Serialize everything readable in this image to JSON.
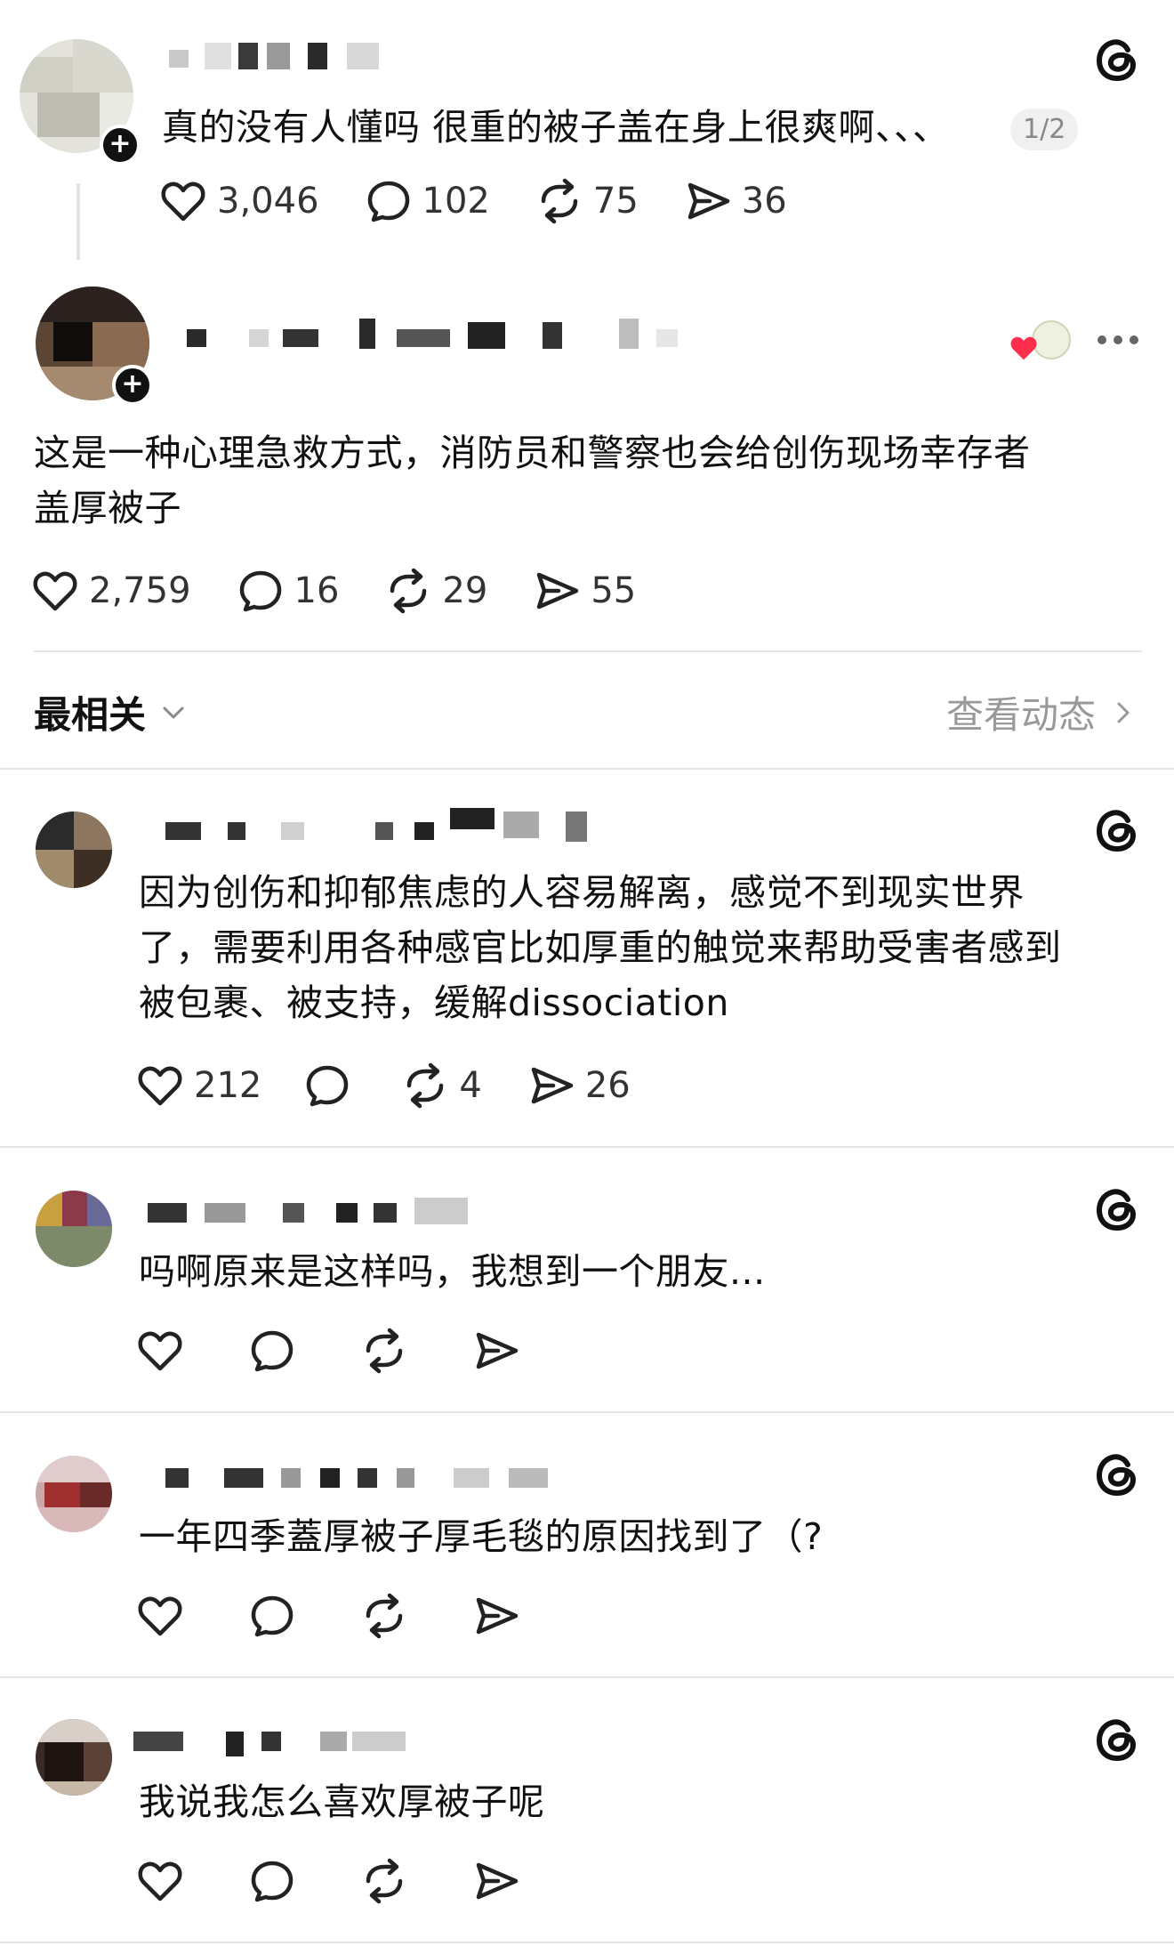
{
  "original_post": {
    "text": "真的没有人懂吗 很重的被子盖在身上很爽啊、、、",
    "pager": "1/2",
    "likes": "3,046",
    "replies": "102",
    "reposts": "75",
    "shares": "36"
  },
  "main_reply": {
    "text_line1": "这是一种心理急救方式，消防员和警察也会给创伤现场幸存者",
    "text_line2": "盖厚被子",
    "likes": "2,759",
    "replies": "16",
    "reposts": "29",
    "shares": "55"
  },
  "sort_bar": {
    "sort_label": "最相关",
    "activity_label": "查看动态"
  },
  "comments": [
    {
      "text_line1": "因为创伤和抑郁焦虑的人容易解离，感觉不到现实世界",
      "text_line2": "了，需要利用各种感官比如厚重的触觉来帮助受害者感到",
      "text_line3": "被包裹、被支持，缓解dissociation",
      "likes": "212",
      "replies": "",
      "reposts": "4",
      "shares": "26"
    },
    {
      "text": "吗啊原来是这样吗，我想到一个朋友..."
    },
    {
      "text": "一年四季蓋厚被子厚毛毯的原因找到了（?"
    },
    {
      "text": "我说我怎么喜欢厚被子呢"
    }
  ],
  "colors": {
    "text": "#111111",
    "muted": "#999999",
    "divider": "#e6e6e6",
    "heart_red": "#ff2e4d"
  }
}
